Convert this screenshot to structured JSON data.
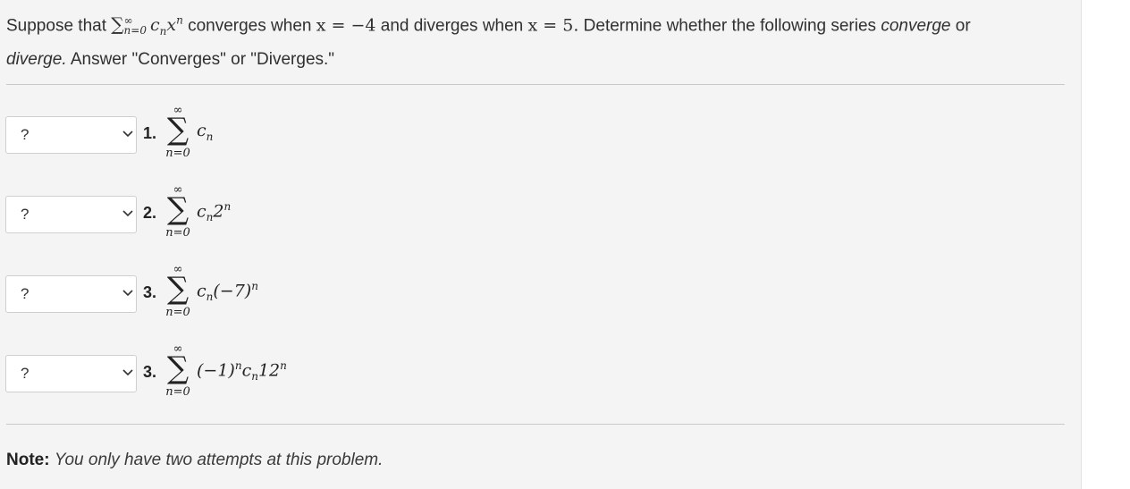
{
  "prompt": {
    "lead": "Suppose that",
    "sum_upper": "∞",
    "sum_lower": "n=0",
    "sum_term": "c",
    "sum_term_sub": "n",
    "sum_term_x": "x",
    "sum_term_sup": "n",
    "mid1": " converges when ",
    "cond1": "x = −4",
    "mid2": " and diverges when ",
    "cond2": "x = 5.",
    "mid3": " Determine whether the following series ",
    "word_converge": "converge",
    "mid4": " or ",
    "word_diverge": "diverge.",
    "tail": " Answer \"Converges\" or \"Diverges.\""
  },
  "items": [
    {
      "selected": "?",
      "number": "1.",
      "upper": "∞",
      "lower": "n=0",
      "expr": "c<sub>n</sub>"
    },
    {
      "selected": "?",
      "number": "2.",
      "upper": "∞",
      "lower": "n=0",
      "expr": "c<sub>n</sub>2<sup>n</sup>"
    },
    {
      "selected": "?",
      "number": "3.",
      "upper": "∞",
      "lower": "n=0",
      "expr": "c<sub>n</sub>(−7)<sup>n</sup>"
    },
    {
      "selected": "?",
      "number": "3.",
      "upper": "∞",
      "lower": "n=0",
      "expr": "(−1)<sup>n</sup>c<sub>n</sub>12<sup>n</sup>"
    }
  ],
  "note": {
    "label": "Note:",
    "text": "You only have two attempts at this problem."
  }
}
